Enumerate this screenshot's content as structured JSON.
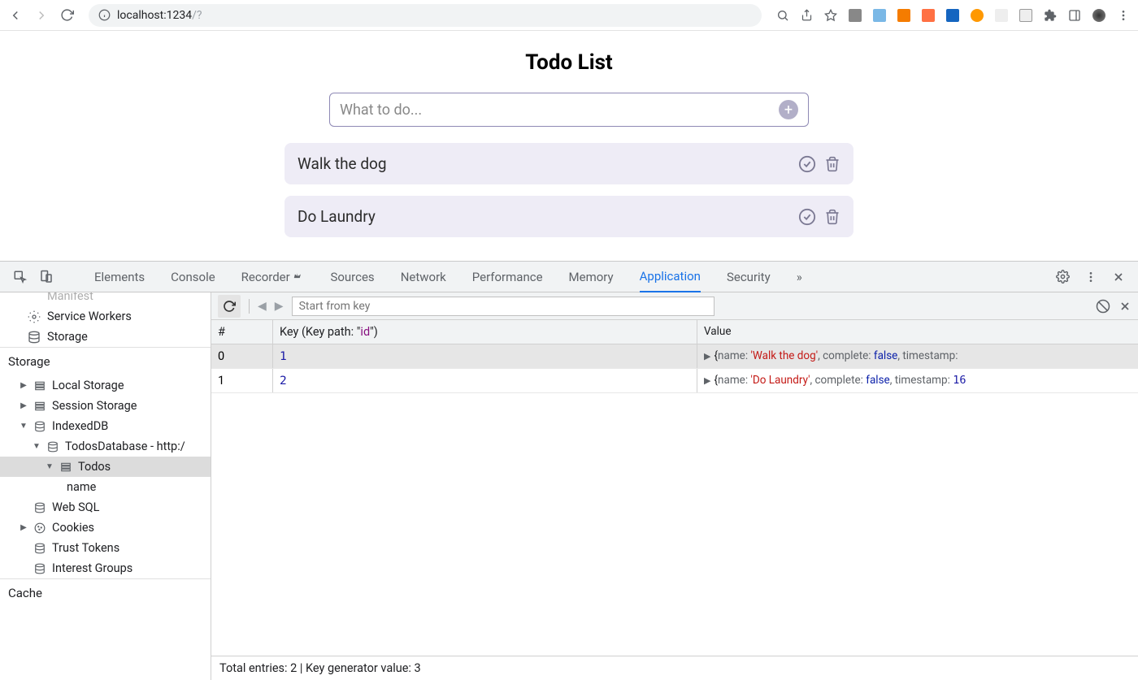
{
  "browser": {
    "url_host": "localhost:",
    "url_port": "1234",
    "url_path": "/?"
  },
  "app": {
    "title": "Todo List",
    "input_placeholder": "What to do...",
    "todos": [
      {
        "text": "Walk the dog"
      },
      {
        "text": "Do Laundry"
      }
    ]
  },
  "devtools": {
    "tabs": [
      "Elements",
      "Console",
      "Recorder",
      "Sources",
      "Network",
      "Performance",
      "Memory",
      "Application",
      "Security"
    ],
    "active_tab": "Application",
    "sidebar": {
      "manifest_cut": "Manifest",
      "service_workers": "Service Workers",
      "storage": "Storage",
      "storage_header": "Storage",
      "local_storage": "Local Storage",
      "session_storage": "Session Storage",
      "indexeddb": "IndexedDB",
      "todos_db": "TodosDatabase - http:/",
      "todos_store": "Todos",
      "index_name": "name",
      "web_sql": "Web SQL",
      "cookies": "Cookies",
      "trust_tokens": "Trust Tokens",
      "interest_groups": "Interest Groups",
      "cache_header": "Cache"
    },
    "toolbar": {
      "key_placeholder": "Start from key"
    },
    "table": {
      "col_index": "#",
      "col_key_prefix": "Key (Key path: \"",
      "col_key_id": "id",
      "col_key_suffix": "\")",
      "col_value": "Value",
      "rows": [
        {
          "index": "0",
          "key": "1",
          "name": "Walk the dog",
          "complete": "false",
          "ts_label": "timestamp:",
          "ts_tail": ""
        },
        {
          "index": "1",
          "key": "2",
          "name": "Do Laundry",
          "complete": "false",
          "ts_label": "timestamp:",
          "ts_tail": "16"
        }
      ]
    },
    "status": "Total entries: 2 | Key generator value: 3"
  }
}
